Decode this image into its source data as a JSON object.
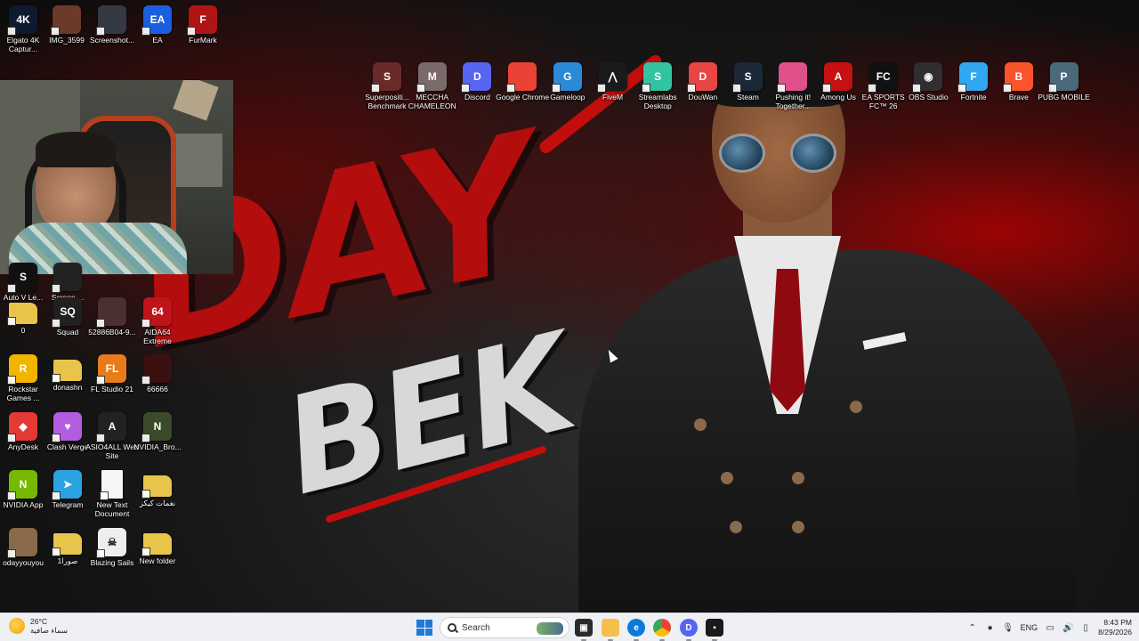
{
  "wallpaper": {
    "title_text": "DAY",
    "subtitle_text": "BEK"
  },
  "desktop_icons": [
    {
      "id": "elgato",
      "label": "Elgato 4K Captur...",
      "glyph": "4K",
      "color": "#0e1a2e",
      "icon": "elgato-icon"
    },
    {
      "id": "img3599",
      "label": "IMG_3599",
      "glyph": "",
      "color": "#6b3a2a",
      "icon": "image-file-icon"
    },
    {
      "id": "screenshot",
      "label": "Screenshot...",
      "glyph": "",
      "color": "#333a44",
      "icon": "image-file-icon"
    },
    {
      "id": "ea",
      "label": "EA",
      "glyph": "EA",
      "color": "#1b5fe0",
      "icon": "ea-icon"
    },
    {
      "id": "furmark",
      "label": "FurMark",
      "glyph": "F",
      "color": "#b01515",
      "icon": "furmark-icon"
    },
    {
      "id": "autov",
      "label": "Auto V Le...",
      "glyph": "S",
      "color": "#111",
      "icon": "app-icon"
    },
    {
      "id": "screen2",
      "label": "Screen ...",
      "glyph": "",
      "color": "#222",
      "icon": "app-icon"
    },
    {
      "id": "folder0",
      "label": "0",
      "glyph": "",
      "color": "#e8c54a",
      "icon": "folder-icon"
    },
    {
      "id": "squad",
      "label": "Squad",
      "glyph": "SQ",
      "color": "#202020",
      "icon": "squad-icon"
    },
    {
      "id": "file5288",
      "label": "52886B04-9...",
      "glyph": "",
      "color": "#4a3030",
      "icon": "image-file-icon"
    },
    {
      "id": "aida64",
      "label": "AIDA64 Extreme",
      "glyph": "64",
      "color": "#c0141b",
      "icon": "aida64-icon"
    },
    {
      "id": "rockstar",
      "label": "Rockstar Games ...",
      "glyph": "R",
      "color": "#f3b400",
      "icon": "rockstar-icon"
    },
    {
      "id": "donashn",
      "label": "donashn",
      "glyph": "",
      "color": "#e8c54a",
      "icon": "folder-icon"
    },
    {
      "id": "flstudio",
      "label": "FL Studio 21",
      "glyph": "FL",
      "color": "#e87b1a",
      "icon": "fl-studio-icon"
    },
    {
      "id": "66666",
      "label": "66666",
      "glyph": "",
      "color": "#3a1010",
      "icon": "image-file-icon"
    },
    {
      "id": "anydesk",
      "label": "AnyDesk",
      "glyph": "◆",
      "color": "#e53935",
      "icon": "anydesk-icon"
    },
    {
      "id": "clashverge",
      "label": "Clash Verge",
      "glyph": "♥",
      "color": "#b45ce0",
      "icon": "clash-verge-icon"
    },
    {
      "id": "asio4all",
      "label": "ASIO4ALL Web Site",
      "glyph": "A",
      "color": "#222",
      "icon": "asio-icon"
    },
    {
      "id": "nvidiabro",
      "label": "NVIDIA_Bro...",
      "glyph": "N",
      "color": "#3a4a2a",
      "icon": "nvidia-icon"
    },
    {
      "id": "nvidiaapp",
      "label": "NVIDIA App",
      "glyph": "N",
      "color": "#76b900",
      "icon": "nvidia-icon"
    },
    {
      "id": "telegram",
      "label": "Telegram",
      "glyph": "➤",
      "color": "#2aa3e0",
      "icon": "telegram-icon"
    },
    {
      "id": "newtext",
      "label": "New Text Document",
      "glyph": "",
      "color": "#f5f5f5",
      "icon": "text-file-icon"
    },
    {
      "id": "arabicfolder",
      "label": "نغمات كيكز",
      "glyph": "",
      "color": "#e8c54a",
      "icon": "folder-icon"
    },
    {
      "id": "odayy",
      "label": "odayyouyou",
      "glyph": "",
      "color": "#8a6a4a",
      "icon": "image-file-icon"
    },
    {
      "id": "folder1",
      "label": "صورا1",
      "glyph": "",
      "color": "#e8c54a",
      "icon": "folder-icon"
    },
    {
      "id": "blazing",
      "label": "Blazing Sails",
      "glyph": "☠",
      "color": "#eee",
      "icon": "blazing-sails-icon"
    },
    {
      "id": "newfolder",
      "label": "New folder",
      "glyph": "",
      "color": "#e8c54a",
      "icon": "folder-icon"
    }
  ],
  "top_row_icons": [
    {
      "id": "superposition",
      "label": "Superpositi... Benchmark",
      "glyph": "S",
      "color": "#6a2a2a",
      "icon": "superposition-icon"
    },
    {
      "id": "meccha",
      "label": "MECCHA CHAMELEON",
      "glyph": "M",
      "color": "#7a6a6a",
      "icon": "app-icon"
    },
    {
      "id": "discord",
      "label": "Discord",
      "glyph": "D",
      "color": "#5865f2",
      "icon": "discord-icon"
    },
    {
      "id": "chrome",
      "label": "Google Chrome",
      "glyph": "",
      "color": "#ea4335",
      "icon": "chrome-icon"
    },
    {
      "id": "gameloop",
      "label": "Gameloop",
      "glyph": "G",
      "color": "#2a8ad8",
      "icon": "gameloop-icon"
    },
    {
      "id": "fivem",
      "label": "FiveM",
      "glyph": "⋀",
      "color": "#1a1a1a",
      "icon": "fivem-icon"
    },
    {
      "id": "streamlabs",
      "label": "Streamlabs Desktop",
      "glyph": "S",
      "color": "#31c3a2",
      "icon": "streamlabs-icon"
    },
    {
      "id": "douwan",
      "label": "DouWan",
      "glyph": "D",
      "color": "#e84545",
      "icon": "douwan-icon"
    },
    {
      "id": "steam",
      "label": "Steam",
      "glyph": "S",
      "color": "#1b2838",
      "icon": "steam-icon"
    },
    {
      "id": "pushing",
      "label": "Pushing it! Together...",
      "glyph": "",
      "color": "#e0508a",
      "icon": "app-icon"
    },
    {
      "id": "amongus",
      "label": "Among Us",
      "glyph": "A",
      "color": "#c51111",
      "icon": "among-us-icon"
    },
    {
      "id": "easports",
      "label": "EA SPORTS FC™ 26",
      "glyph": "FC",
      "color": "#111",
      "icon": "ea-sports-icon"
    },
    {
      "id": "obs",
      "label": "OBS Studio",
      "glyph": "◉",
      "color": "#302e31",
      "icon": "obs-icon"
    },
    {
      "id": "fortnite",
      "label": "Fortnite",
      "glyph": "F",
      "color": "#30a8f0",
      "icon": "fortnite-icon"
    },
    {
      "id": "brave",
      "label": "Brave",
      "glyph": "B",
      "color": "#fb542b",
      "icon": "brave-icon"
    },
    {
      "id": "pubg",
      "label": "PUBG MOBILE",
      "glyph": "P",
      "color": "#4a6a7a",
      "icon": "pubg-icon"
    }
  ],
  "taskbar": {
    "weather_temp": "26°C",
    "weather_desc": "سماء صافية",
    "search_placeholder": "Search",
    "language": "ENG",
    "time": "8:43 PM",
    "date": "8/29/2026"
  }
}
